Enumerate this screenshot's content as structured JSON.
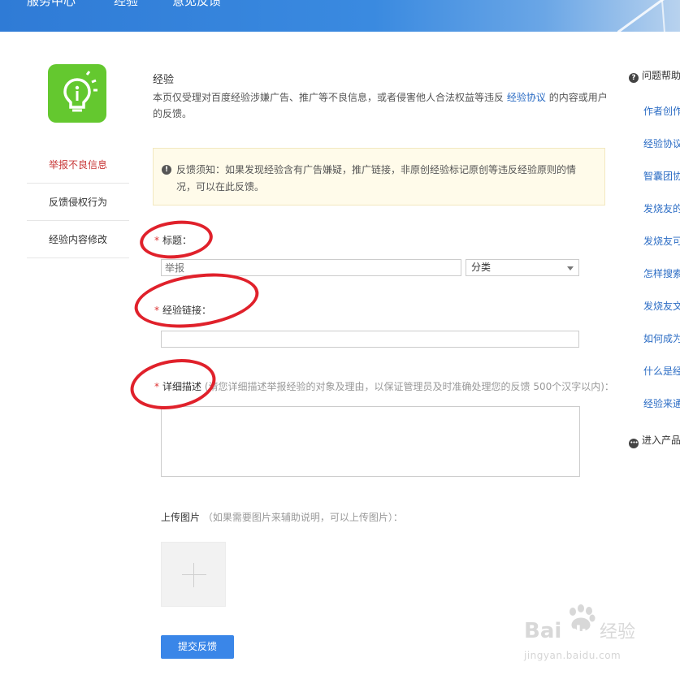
{
  "header": {
    "nav": [
      "服务中心",
      "经验",
      "意见反馈"
    ]
  },
  "sidebar": {
    "items": [
      {
        "label": "举报不良信息",
        "active": true
      },
      {
        "label": "反馈侵权行为",
        "active": false
      },
      {
        "label": "经验内容修改",
        "active": false
      }
    ]
  },
  "main": {
    "title": "经验",
    "intro_before": "本页仅受理对百度经验涉嫌广告、推广等不良信息，或者侵害他人合法权益等违反",
    "intro_link": "经验协议",
    "intro_after": "的内容或用户的反馈。",
    "notice": "反馈须知：如果发现经验含有广告嫌疑，推广链接，非原创经验标记原创等违反经验原则的情况，可以在此反馈。",
    "fields": {
      "title_label": "标题：",
      "title_placeholder": "举报",
      "category_value": "分类",
      "link_label": "经验链接：",
      "desc_label": "详细描述",
      "desc_hint": "(请您详细描述举报经验的对象及理由，以保证管理员及时准确处理您的反馈 500个汉字以内)：",
      "upload_label": "上传图片",
      "upload_hint": "（如果需要图片来辅助说明，可以上传图片）："
    },
    "submit_label": "提交反馈"
  },
  "help": {
    "title": "问题帮助",
    "links": [
      "作者创作",
      "经验协议",
      "智囊团协",
      "发烧友的",
      "发烧友可",
      "怎样搜索",
      "发烧友文",
      "如何成为",
      "什么是经",
      "经验来通"
    ],
    "enter_label": "进入产品"
  },
  "watermark": {
    "brand": "Bai",
    "brand2": "du",
    "cn": "经验",
    "url": "jingyan.baidu.com"
  },
  "colors": {
    "accent": "#3a86e8",
    "link": "#2b6cc4",
    "logo_bg": "#64c82f",
    "active": "#c83737",
    "annotation": "#e0212b"
  }
}
